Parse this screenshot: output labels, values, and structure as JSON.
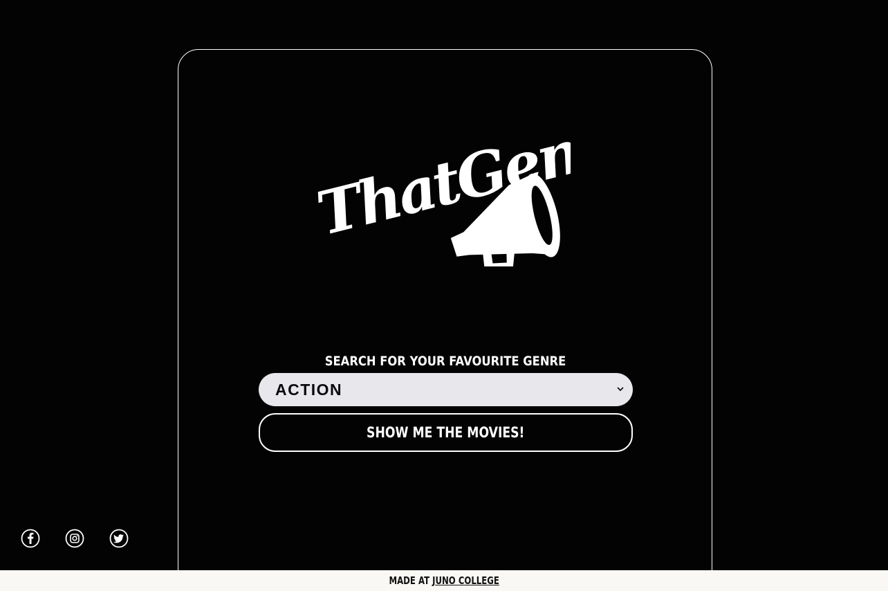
{
  "brand": {
    "logo_text": "ThatGenre"
  },
  "search": {
    "label": "SEARCH FOR YOUR FAVOURITE GENRE",
    "selected_genre": "ACTION",
    "submit_label": "SHOW ME THE MOVIES!"
  },
  "social": {
    "icons": [
      "facebook-icon",
      "instagram-icon",
      "twitter-icon"
    ]
  },
  "footer": {
    "prefix": "MADE AT",
    "link_text": "JUNO COLLEGE"
  },
  "colors": {
    "background": "#030303",
    "select_bg": "#e8e7ec",
    "footer_bg": "#f9f8f4",
    "accent": "#ffffff"
  }
}
